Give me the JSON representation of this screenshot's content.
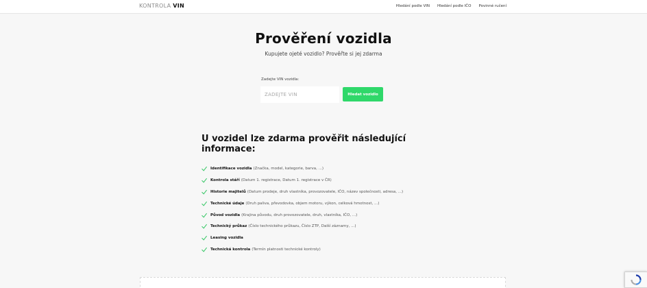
{
  "header": {
    "logo_light": "KONTROLA",
    "logo_bold": "VIN",
    "nav": [
      "Hledání podle VIN",
      "Hledání podle IČO",
      "Povinné ručení"
    ]
  },
  "hero": {
    "title": "Prověření vozidla",
    "subtitle": "Kupujete ojeté vozidlo? Prověřte si jej zdarma"
  },
  "search": {
    "label": "Zadejte VIN vozidla:",
    "placeholder": "ZADEJTE VIN",
    "button_label": "Hledat vozidlo"
  },
  "info": {
    "title": "U vozidel lze zdarma prověřit následující informace:",
    "items": [
      {
        "name": "Identifikace vozidla",
        "detail": "(Značka, model, kategorie, barva, ...)"
      },
      {
        "name": "Kontrola stáří",
        "detail": "(Datum 1. registrace, Datum 1. registrace v ČR)"
      },
      {
        "name": "Historie majitelů",
        "detail": "(Datum prodeje, druh vlastníka, provozovatele, IČO, název společnosti, adresa, ...)"
      },
      {
        "name": "Technické údaje",
        "detail": "(Druh paliva, převodovka, objem motoru, výkon, celková hmotnost, ...)"
      },
      {
        "name": "Původ vozidla",
        "detail": "(Krajina původu, druh provozovatele, druh, vlastníka, IČO, ...)"
      },
      {
        "name": "Technický průkaz",
        "detail": "(Číslo technického průkazu, Číslo ZTP, Další záznamy, ...)"
      },
      {
        "name": "Leasing vozidla",
        "detail": ""
      },
      {
        "name": "Technická kontrola",
        "detail": "(Termín platnosti technické kontroly)"
      }
    ]
  },
  "colors": {
    "accent": "#2fd86a",
    "check": "#3cc96a"
  }
}
